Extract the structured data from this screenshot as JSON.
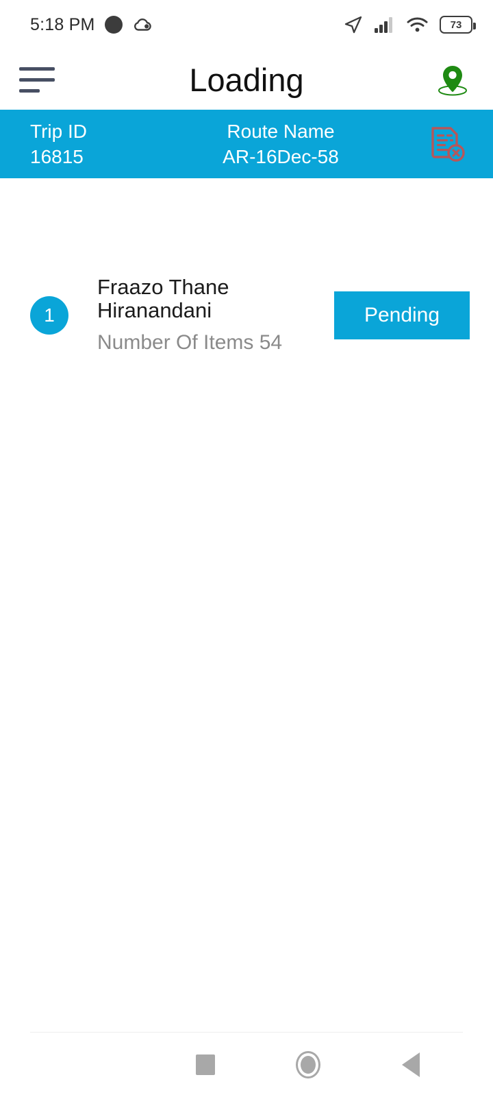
{
  "theme": {
    "brand_blue": "#0AA5D8",
    "pin_green": "#1E8A12",
    "doc_red": "#B5575A",
    "nav_gray": "#A8A8A8",
    "subtext_gray": "#8A8A8A"
  },
  "status_bar": {
    "time": "5:18 PM",
    "dot_icon": "circle-filled-icon",
    "cloud_icon": "cloud-icon",
    "location_arrow_icon": "navigation-arrow-icon",
    "signal_icon": "cellular-signal-icon",
    "wifi_icon": "wifi-icon",
    "battery_icon": "battery-icon",
    "battery_level": "73"
  },
  "app_bar": {
    "menu_icon": "hamburger-menu-icon",
    "title": "Loading",
    "location_pin_icon": "map-pin-icon"
  },
  "trip_bar": {
    "trip_id_label": "Trip ID",
    "trip_id_value": "16815",
    "route_name_label": "Route Name",
    "route_name_value": "AR-16Dec-58",
    "document_icon": "document-cancel-icon"
  },
  "list": {
    "rows": [
      {
        "index": "1",
        "title": "Fraazo Thane Hiranandani",
        "subtitle": "Number Of Items 54",
        "status": "Pending"
      }
    ]
  },
  "nav_bar": {
    "recents_icon": "square-recents-icon",
    "home_icon": "circle-home-icon",
    "back_icon": "triangle-back-icon"
  }
}
